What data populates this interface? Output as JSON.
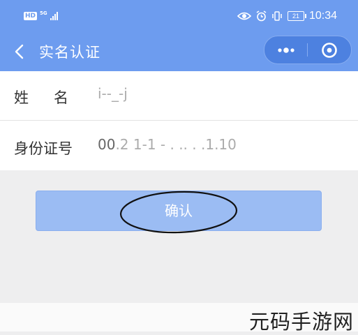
{
  "status_bar": {
    "hd_badge": "HD",
    "network": "5G",
    "battery": "21",
    "time": "10:34"
  },
  "nav": {
    "title": "实名认证",
    "icons": [
      "back-arrow-icon",
      "more-dots-icon",
      "close-target-icon"
    ]
  },
  "form": {
    "name_label": "姓名",
    "name_value": "i--_-j",
    "id_label": "身份证号",
    "id_value": "00.2 1-1 - . .. . .1.10"
  },
  "confirm_button": {
    "label": "确认"
  },
  "watermark": {
    "text": "元码手游网"
  },
  "colors": {
    "header_blue": "#6d9cef",
    "capsule_blue": "#4d81e0",
    "button_blue": "#9bbcf3",
    "background": "#eeeeef"
  }
}
